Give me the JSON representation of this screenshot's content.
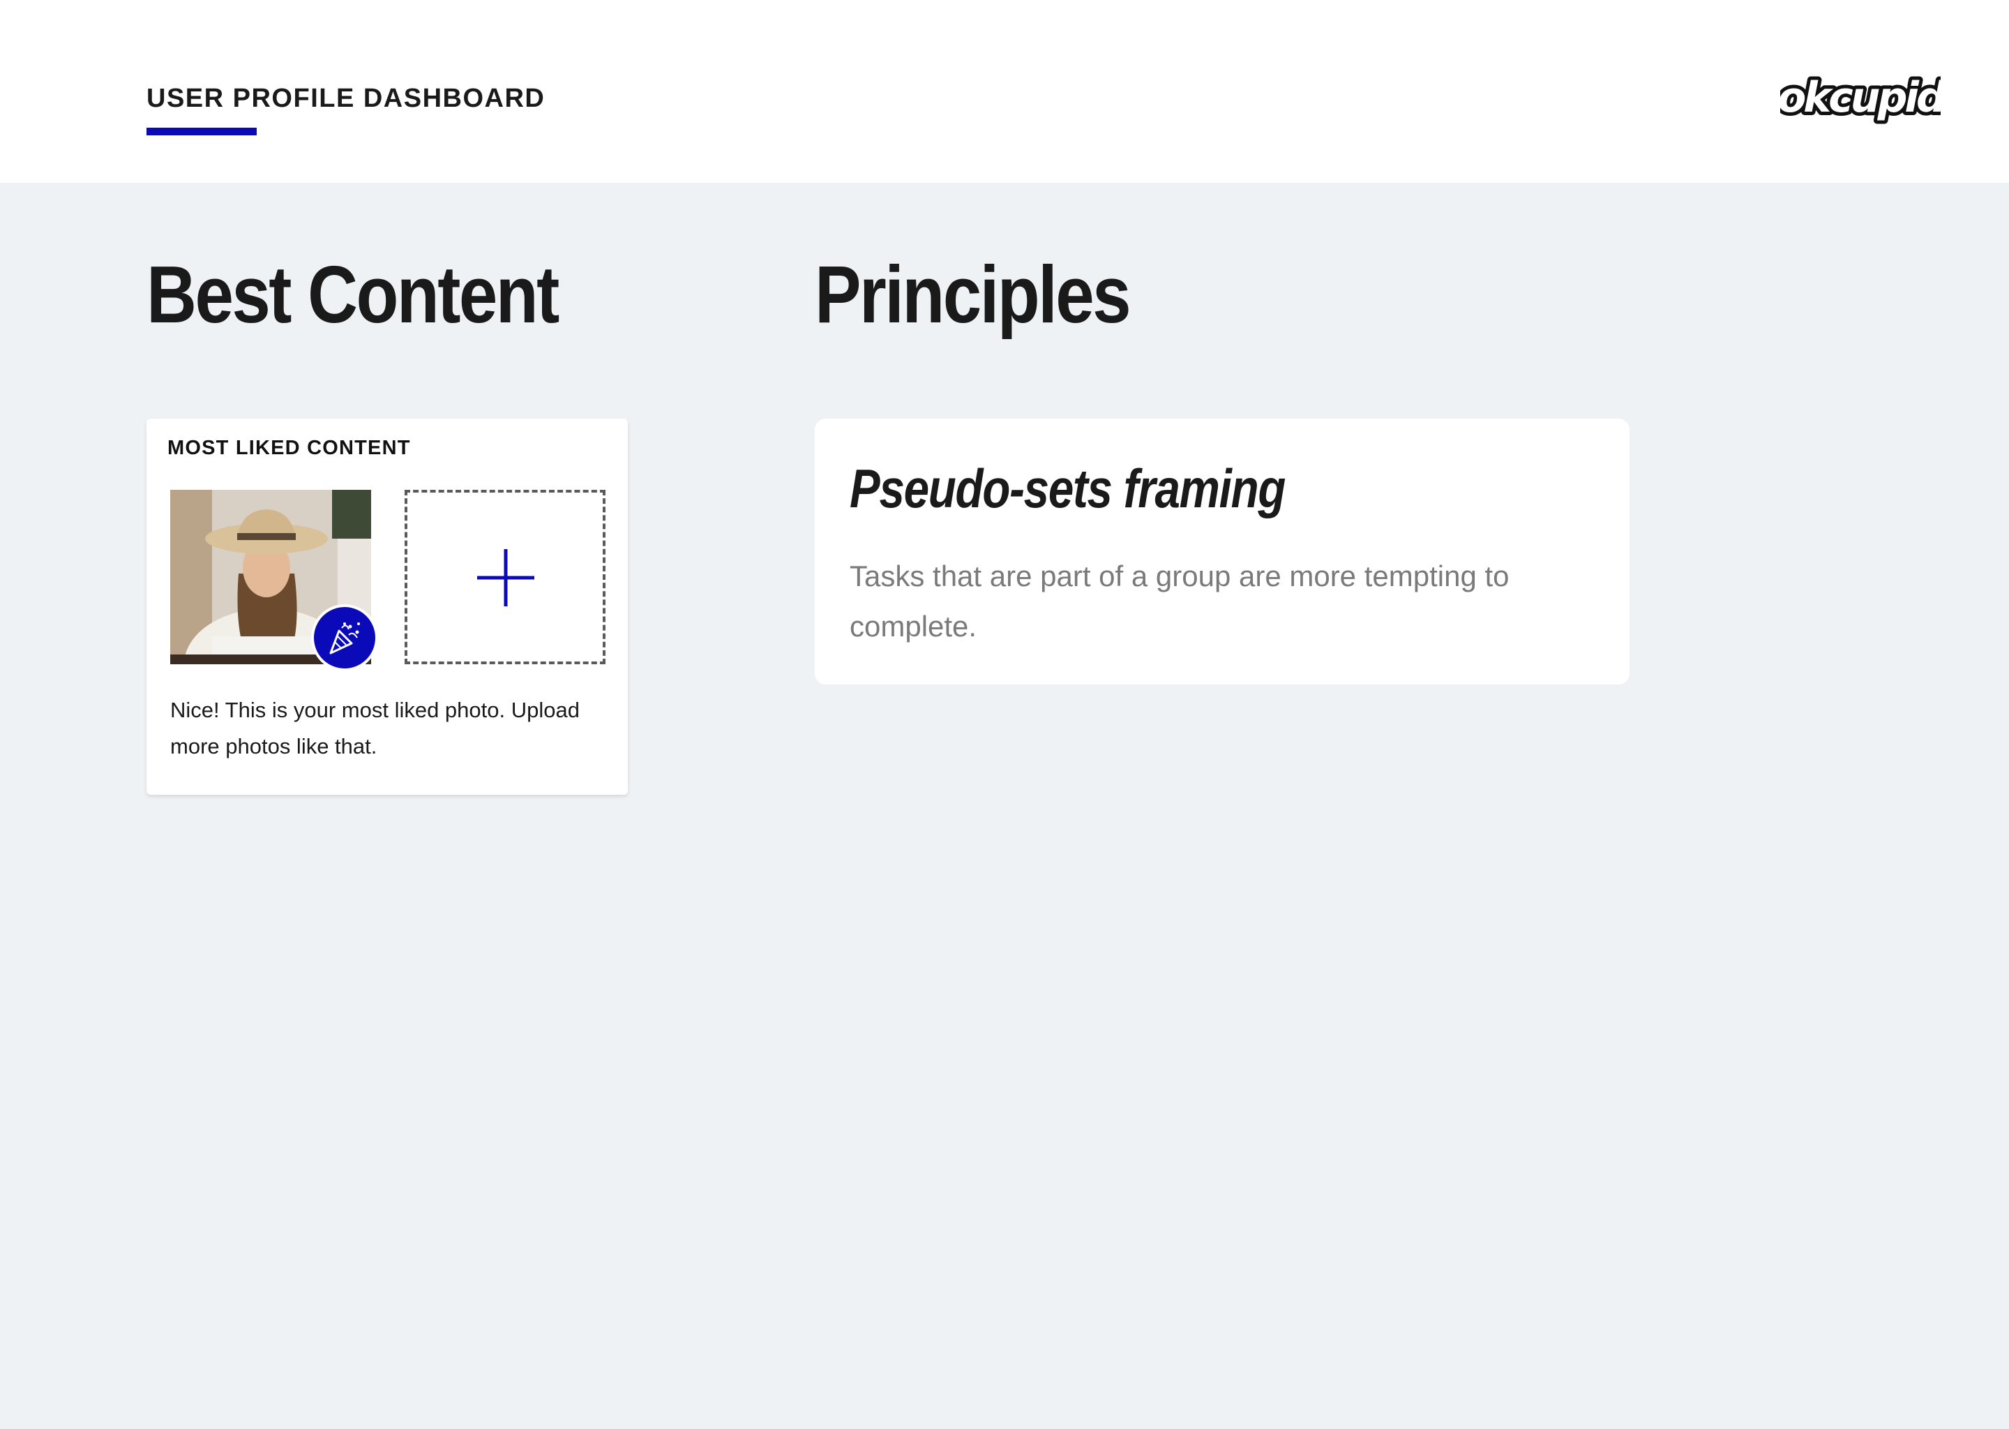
{
  "header": {
    "nav_tab_label": "USER PROFILE DASHBOARD",
    "accent_color": "#0a0ab8",
    "logo_text": "okcupid"
  },
  "best_content": {
    "section_title": "Best Content",
    "card": {
      "heading": "MOST LIKED CONTENT",
      "photo_icon": "photo-thumbnail",
      "badge_icon": "party-popper-icon",
      "add_icon": "plus-icon",
      "body": "Nice! This is your most liked photo. Upload more photos like that."
    }
  },
  "principles": {
    "section_title": "Principles",
    "card": {
      "title": "Pseudo-sets framing",
      "description": "Tasks that are part of a group are more tempting to complete."
    }
  }
}
